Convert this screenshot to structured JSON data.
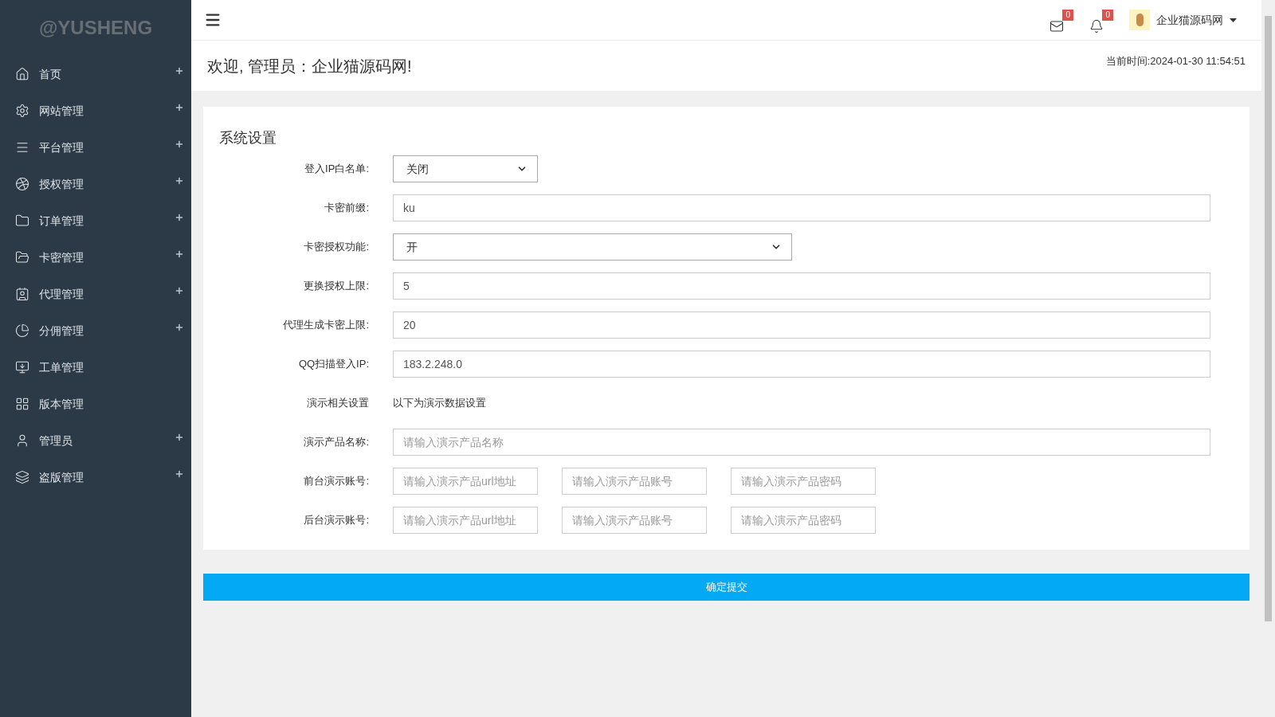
{
  "sidebar": {
    "logo": "@YUSHENG",
    "items": [
      {
        "label": "首页",
        "expandable": true
      },
      {
        "label": "网站管理",
        "expandable": true
      },
      {
        "label": "平台管理",
        "expandable": true
      },
      {
        "label": "授权管理",
        "expandable": true
      },
      {
        "label": "订单管理",
        "expandable": true
      },
      {
        "label": "卡密管理",
        "expandable": true
      },
      {
        "label": "代理管理",
        "expandable": true
      },
      {
        "label": "分佣管理",
        "expandable": true
      },
      {
        "label": "工单管理",
        "expandable": false
      },
      {
        "label": "版本管理",
        "expandable": false
      },
      {
        "label": "管理员",
        "expandable": true
      },
      {
        "label": "盗版管理",
        "expandable": true
      }
    ]
  },
  "header": {
    "mail_count": "0",
    "bell_count": "0",
    "user_name": "企业猫源码网"
  },
  "welcome": "欢迎, 管理员：企业猫源码网!",
  "current_time": "当前时间:2024-01-30 11:54:51",
  "form": {
    "title": "系统设置",
    "rows": [
      {
        "kind": "short-select",
        "label": "登入IP白名单:",
        "value": "关闭"
      },
      {
        "kind": "input",
        "label": "卡密前缀:",
        "value": "ku"
      },
      {
        "kind": "select",
        "label": "卡密授权功能:",
        "value": "开"
      },
      {
        "kind": "input",
        "label": "更换授权上限:",
        "value": "5"
      },
      {
        "kind": "input",
        "label": "代理生成卡密上限:",
        "value": "20"
      },
      {
        "kind": "input",
        "label": "QQ扫描登入IP:",
        "value": "183.2.248.0"
      },
      {
        "kind": "text",
        "label": "演示相关设置",
        "value": "以下为演示数据设置"
      },
      {
        "kind": "input",
        "label": "演示产品名称:",
        "placeholder": "请输入演示产品名称"
      },
      {
        "kind": "triple",
        "label": "前台演示账号:",
        "placeholders": [
          "请输入演示产品url地址",
          "请输入演示产品账号",
          "请输入演示产品密码"
        ]
      },
      {
        "kind": "triple",
        "label": "后台演示账号:",
        "placeholders": [
          "请输入演示产品url地址",
          "请输入演示产品账号",
          "请输入演示产品密码"
        ]
      }
    ]
  },
  "submit": "确定提交"
}
